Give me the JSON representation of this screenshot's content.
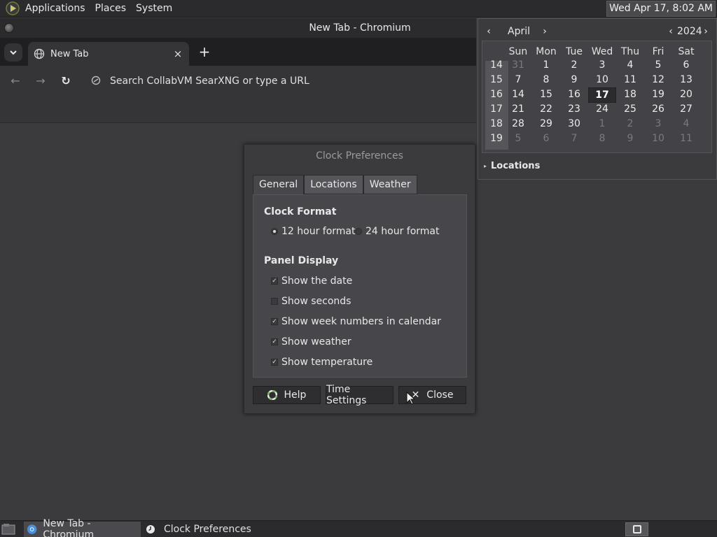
{
  "top_panel": {
    "menus": [
      "Applications",
      "Places",
      "System"
    ],
    "clock": "Wed Apr 17,  8:02 AM"
  },
  "chromium": {
    "window_title": "New Tab - Chromium",
    "tab_title": "New Tab",
    "tab_close": "×",
    "new_tab": "+",
    "address_placeholder": "Search CollabVM SearXNG or type a URL",
    "nav": {
      "back": "←",
      "forward": "→",
      "reload": "↻"
    }
  },
  "calendar": {
    "month": "April",
    "year": "2024",
    "prev_month": "‹",
    "next_month": "›",
    "prev_year": "‹",
    "next_year": "›",
    "day_names": [
      "Sun",
      "Mon",
      "Tue",
      "Wed",
      "Thu",
      "Fri",
      "Sat"
    ],
    "weeks": [
      {
        "num": "14",
        "days": [
          "31",
          "1",
          "2",
          "3",
          "4",
          "5",
          "6"
        ],
        "other": [
          true,
          false,
          false,
          false,
          false,
          false,
          false
        ]
      },
      {
        "num": "15",
        "days": [
          "7",
          "8",
          "9",
          "10",
          "11",
          "12",
          "13"
        ],
        "other": [
          false,
          false,
          false,
          false,
          false,
          false,
          false
        ]
      },
      {
        "num": "16",
        "days": [
          "14",
          "15",
          "16",
          "17",
          "18",
          "19",
          "20"
        ],
        "other": [
          false,
          false,
          false,
          false,
          false,
          false,
          false
        ]
      },
      {
        "num": "17",
        "days": [
          "21",
          "22",
          "23",
          "24",
          "25",
          "26",
          "27"
        ],
        "other": [
          false,
          false,
          false,
          false,
          false,
          false,
          false
        ]
      },
      {
        "num": "18",
        "days": [
          "28",
          "29",
          "30",
          "1",
          "2",
          "3",
          "4"
        ],
        "other": [
          false,
          false,
          false,
          true,
          true,
          true,
          true
        ]
      },
      {
        "num": "19",
        "days": [
          "5",
          "6",
          "7",
          "8",
          "9",
          "10",
          "11"
        ],
        "other": [
          true,
          true,
          true,
          true,
          true,
          true,
          true
        ]
      }
    ],
    "today": "17",
    "locations_label": "Locations"
  },
  "prefs": {
    "title": "Clock Preferences",
    "tabs": [
      "General",
      "Locations",
      "Weather"
    ],
    "clock_format_title": "Clock Format",
    "format_12": "12 hour format",
    "format_24": "24 hour format",
    "panel_display_title": "Panel Display",
    "options": [
      {
        "label": "Show the date",
        "checked": true
      },
      {
        "label": "Show seconds",
        "checked": false
      },
      {
        "label": "Show week numbers in calendar",
        "checked": true
      },
      {
        "label": "Show weather",
        "checked": true
      },
      {
        "label": "Show temperature",
        "checked": true
      }
    ],
    "help_label": "Help",
    "time_settings_label": "Time Settings",
    "close_label": "Close"
  },
  "taskbar": {
    "tasks": [
      "New Tab - Chromium",
      "Clock Preferences"
    ]
  }
}
